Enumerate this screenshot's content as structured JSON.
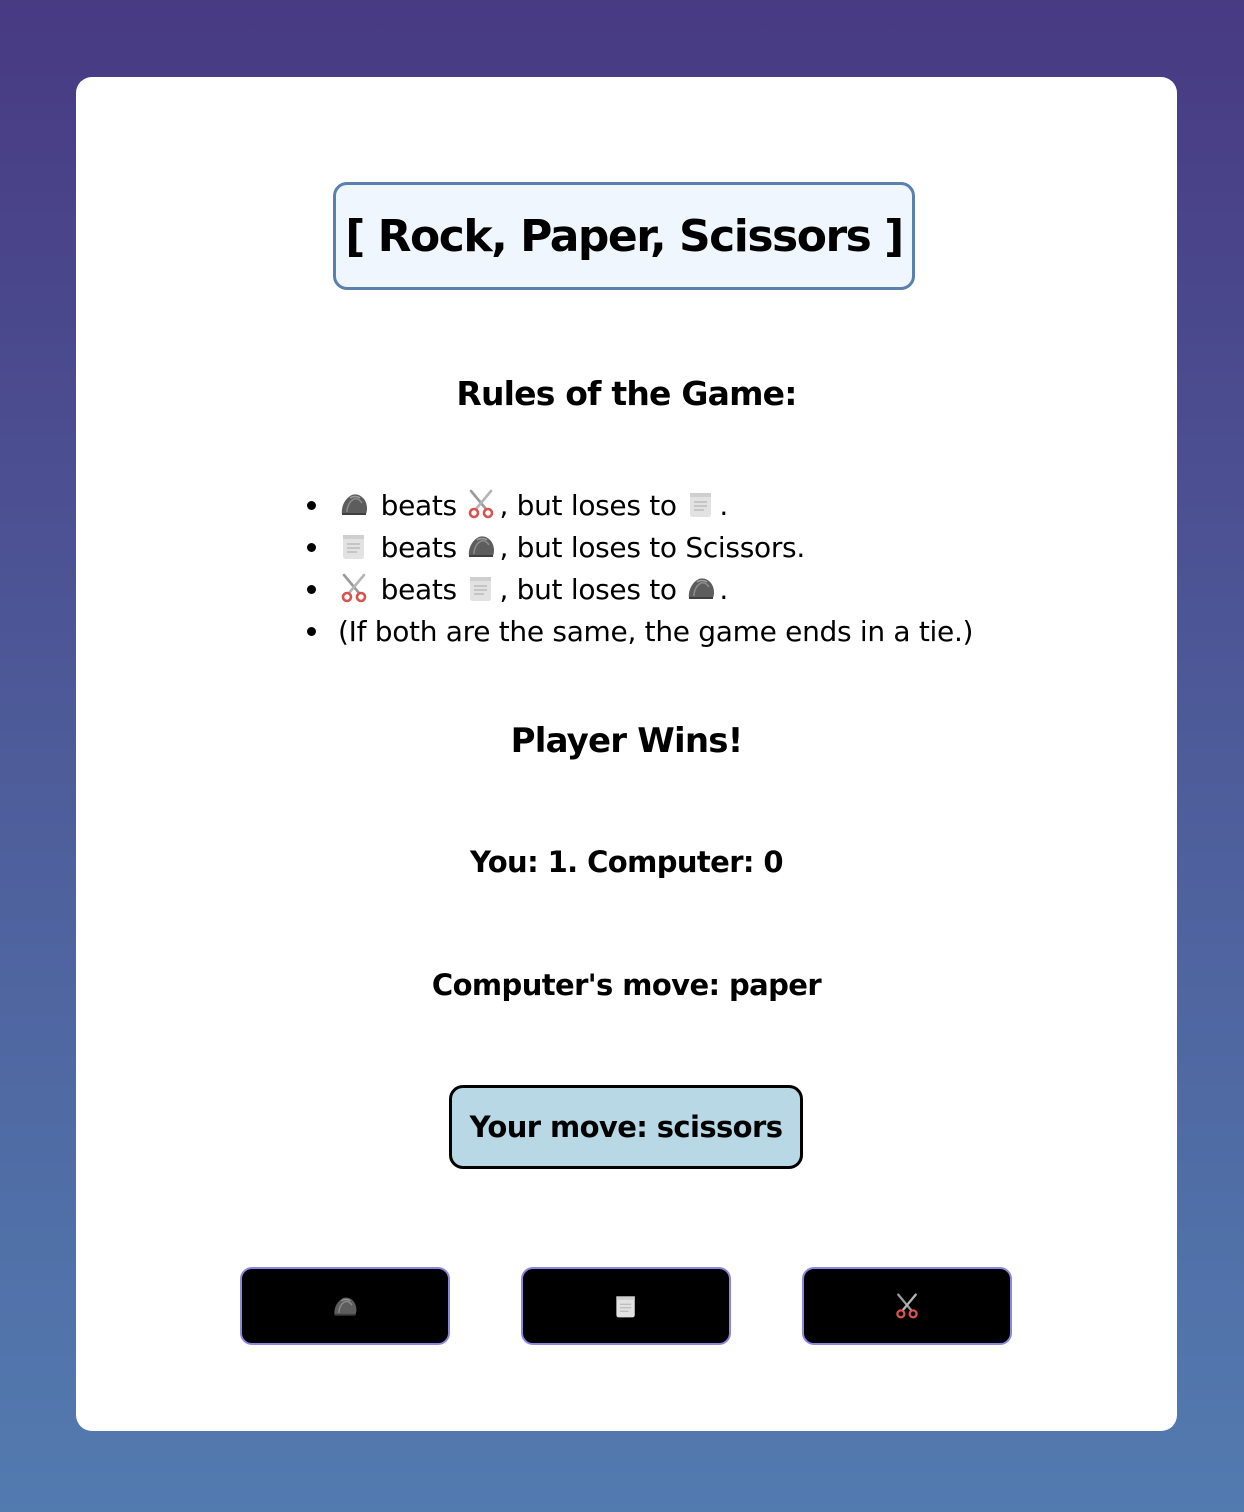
{
  "title": "[ Rock, Paper, Scissors ]",
  "rules": {
    "heading": "Rules of the Game:",
    "items": [
      {
        "icon": "rock-icon",
        "beats_text": " beats ",
        "beats_icon": "scissors-icon",
        "loses_text": ", but loses to ",
        "loses_icon": "paper-icon",
        "end": "."
      },
      {
        "icon": "paper-icon",
        "beats_text": " beats ",
        "beats_icon": "rock-icon",
        "loses_text": ", but loses to Scissors."
      },
      {
        "icon": "scissors-icon",
        "beats_text": " beats ",
        "beats_icon": "paper-icon",
        "loses_text": ", but loses to ",
        "loses_icon": "rock-icon",
        "end": "."
      },
      {
        "text": "(If both are the same, the game ends in a tie.)"
      }
    ]
  },
  "result": "Player Wins!",
  "score": "You: 1. Computer: 0",
  "computer_move": "Computer's move: paper",
  "your_move": "Your move: scissors",
  "buttons": [
    {
      "icon": "rock-icon"
    },
    {
      "icon": "paper-icon"
    },
    {
      "icon": "scissors-icon"
    }
  ],
  "colors": {
    "background_top": "#483a83",
    "background_bottom": "#527bb0",
    "title_border": "#5a80ad",
    "title_fill": "#f0f6fd",
    "your_move_fill": "#b7d8e4",
    "button_fill": "#000000",
    "button_border": "#8b86e0"
  }
}
